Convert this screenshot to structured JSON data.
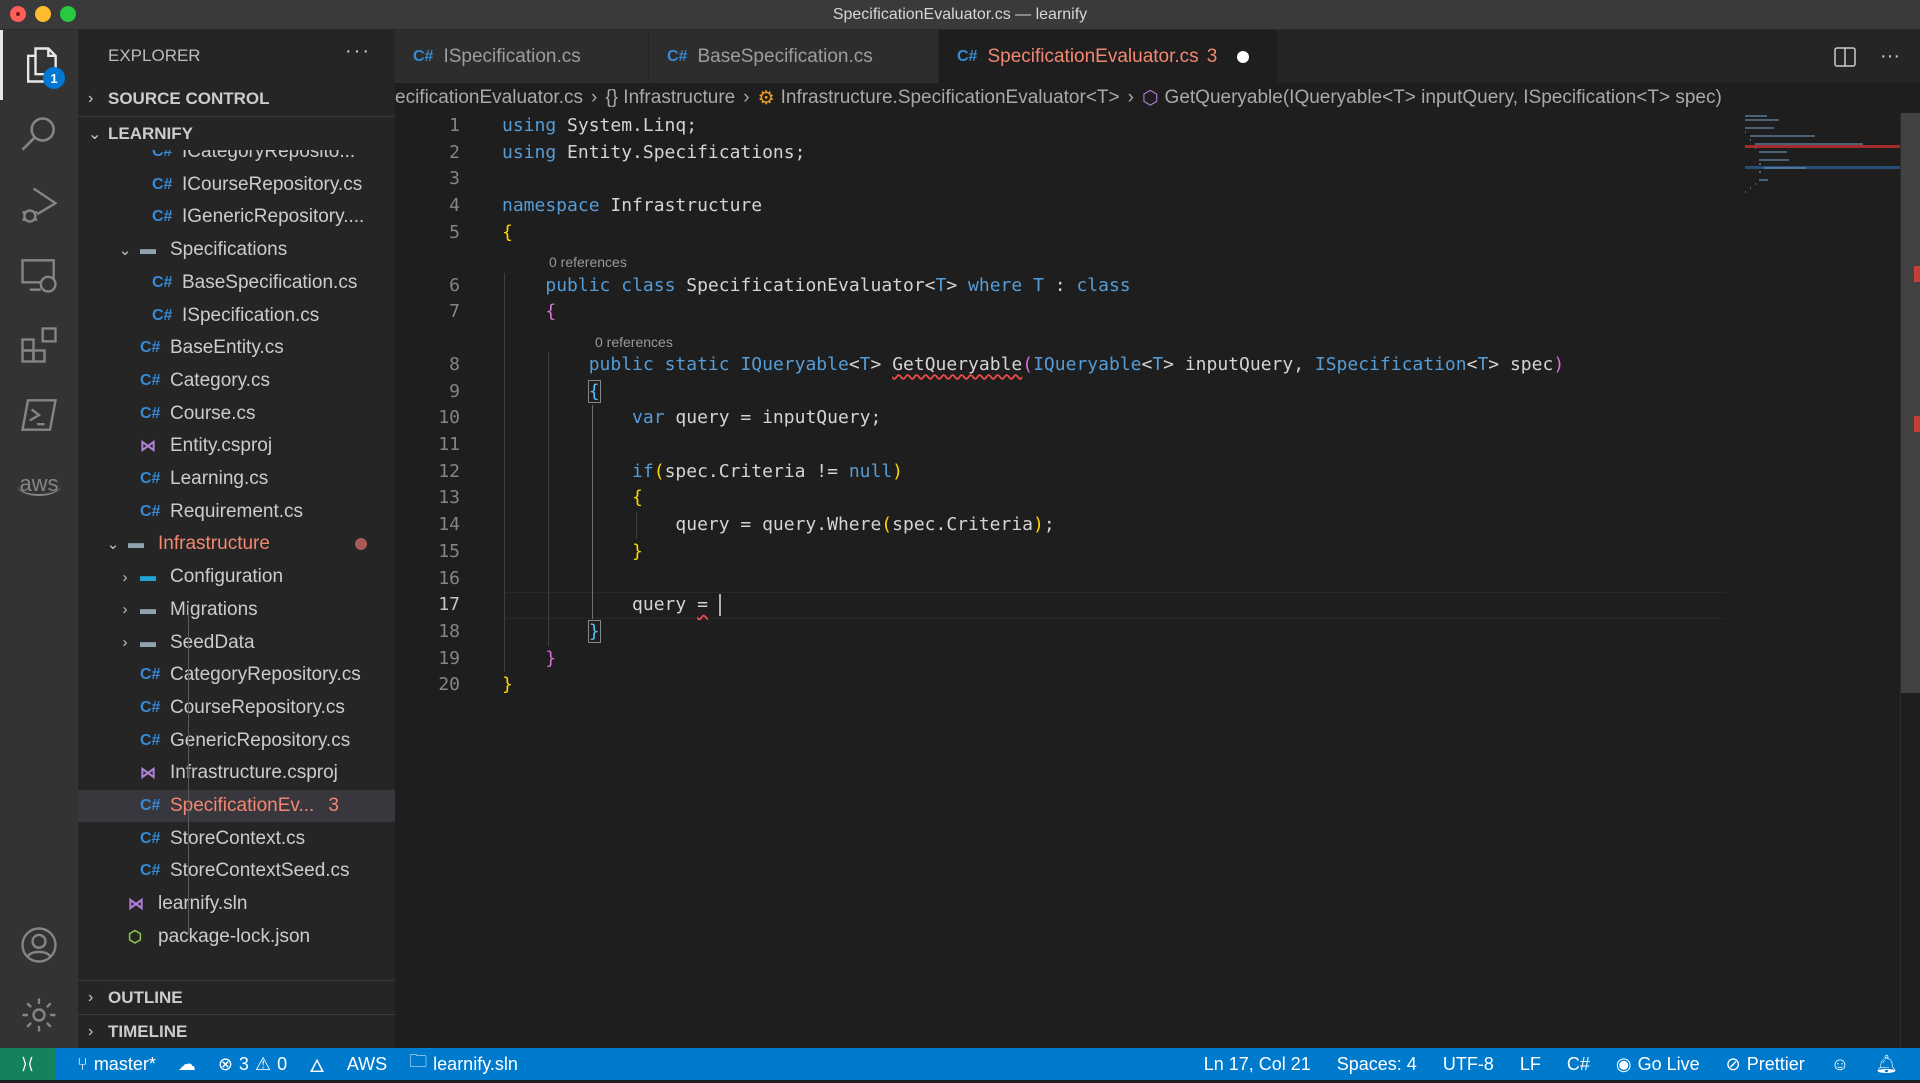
{
  "window": {
    "title": "SpecificationEvaluator.cs — learnify"
  },
  "activity_bar": {
    "explorer_badge": "1",
    "items": [
      "explorer",
      "search",
      "run-debug",
      "remote-explorer",
      "extensions",
      "powershell",
      "aws",
      "accounts",
      "settings"
    ],
    "aws_label": "aws"
  },
  "sidebar": {
    "title": "EXPLORER",
    "more": "···",
    "sections": {
      "source_control": "SOURCE CONTROL",
      "project": "LEARNIFY",
      "outline": "OUTLINE",
      "timeline": "TIMELINE"
    },
    "tree": [
      {
        "label": "ICategoryReposito...",
        "type": "cs",
        "depth": 3
      },
      {
        "label": "ICourseRepository.cs",
        "type": "cs",
        "depth": 3
      },
      {
        "label": "IGenericRepository....",
        "type": "cs",
        "depth": 3
      },
      {
        "label": "Specifications",
        "type": "folder-open",
        "depth": 2,
        "expanded": true
      },
      {
        "label": "BaseSpecification.cs",
        "type": "cs",
        "depth": 3
      },
      {
        "label": "ISpecification.cs",
        "type": "cs",
        "depth": 3
      },
      {
        "label": "BaseEntity.cs",
        "type": "cs",
        "depth": 2
      },
      {
        "label": "Category.cs",
        "type": "cs",
        "depth": 2
      },
      {
        "label": "Course.cs",
        "type": "cs",
        "depth": 2
      },
      {
        "label": "Entity.csproj",
        "type": "csproj",
        "depth": 2
      },
      {
        "label": "Learning.cs",
        "type": "cs",
        "depth": 2
      },
      {
        "label": "Requirement.cs",
        "type": "cs",
        "depth": 2
      },
      {
        "label": "Infrastructure",
        "type": "folder-open",
        "depth": 1,
        "expanded": true,
        "modified": true
      },
      {
        "label": "Configuration",
        "type": "folder-config",
        "depth": 2,
        "expanded": false
      },
      {
        "label": "Migrations",
        "type": "folder",
        "depth": 2,
        "expanded": false
      },
      {
        "label": "SeedData",
        "type": "folder",
        "depth": 2,
        "expanded": false
      },
      {
        "label": "CategoryRepository.cs",
        "type": "cs",
        "depth": 2
      },
      {
        "label": "CourseRepository.cs",
        "type": "cs",
        "depth": 2
      },
      {
        "label": "GenericRepository.cs",
        "type": "cs",
        "depth": 2
      },
      {
        "label": "Infrastructure.csproj",
        "type": "csproj",
        "depth": 2
      },
      {
        "label": "SpecificationEv...",
        "type": "cs",
        "depth": 2,
        "selected": true,
        "modified": true,
        "problems": "3"
      },
      {
        "label": "StoreContext.cs",
        "type": "cs",
        "depth": 2
      },
      {
        "label": "StoreContextSeed.cs",
        "type": "cs",
        "depth": 2
      },
      {
        "label": "learnify.sln",
        "type": "sln",
        "depth": 1
      },
      {
        "label": "package-lock.json",
        "type": "json",
        "depth": 1
      }
    ]
  },
  "tabs": [
    {
      "icon": "C#",
      "label": "ISpecification.cs",
      "active": false
    },
    {
      "icon": "C#",
      "label": "BaseSpecification.cs",
      "active": false
    },
    {
      "icon": "C#",
      "label": "SpecificationEvaluator.cs",
      "active": true,
      "problems": "3",
      "dirty": true
    }
  ],
  "breadcrumb": [
    "ecificationEvaluator.cs",
    "{} Infrastructure",
    "Infrastructure.SpecificationEvaluator<T>",
    "GetQueryable(IQueryable<T> inputQuery, ISpecification<T> spec)"
  ],
  "editor": {
    "codelens": [
      "0 references",
      "0 references"
    ],
    "lines": [
      "using System.Linq;",
      "using Entity.Specifications;",
      "",
      "namespace Infrastructure",
      "{",
      "    public class SpecificationEvaluator<T> where T : class",
      "    {",
      "        public static IQueryable<T> GetQueryable(IQueryable<T> inputQuery, ISpecification<T> spec)",
      "        {",
      "            var query = inputQuery;",
      "",
      "            if(spec.Criteria != null)",
      "            {",
      "                query = query.Where(spec.Criteria);",
      "            }",
      "",
      "            query = ",
      "        }",
      "    }",
      "}"
    ],
    "current_line": 17
  },
  "statusbar": {
    "branch": "master*",
    "errors": "3",
    "warnings": "0",
    "aws": "AWS",
    "solution": "learnify.sln",
    "position": "Ln 17, Col 21",
    "spaces": "Spaces: 4",
    "encoding": "UTF-8",
    "eol": "LF",
    "language": "C#",
    "go_live": "Go Live",
    "prettier": "Prettier"
  },
  "colors": {
    "statusbar": "#007acc",
    "remote": "#16825d",
    "modified": "#f48771",
    "csharp_icon": "#368ad6"
  }
}
